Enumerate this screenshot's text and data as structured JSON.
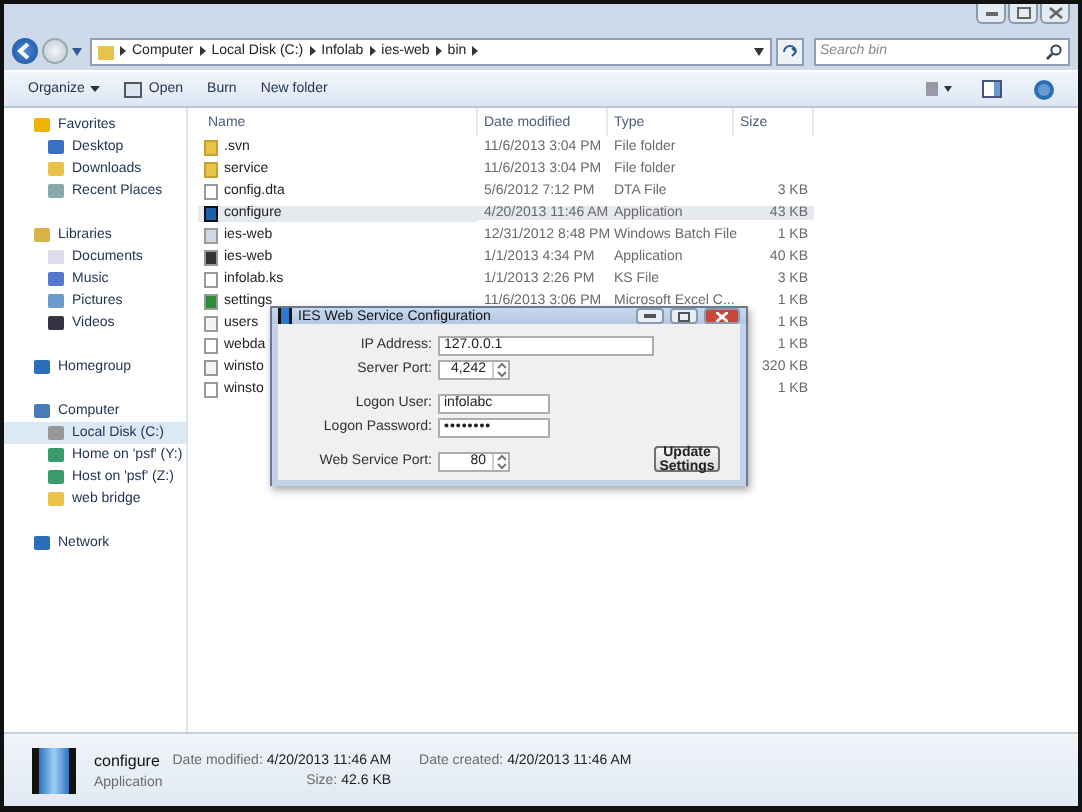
{
  "address_bar": {
    "segments": [
      "Computer",
      "Local Disk (C:)",
      "Infolab",
      "ies-web",
      "bin"
    ]
  },
  "search": {
    "placeholder": "Search bin"
  },
  "toolbar": {
    "buttons": [
      {
        "label": "Organize",
        "kind": "menu"
      },
      {
        "label": "Open",
        "kind": "open"
      },
      {
        "label": "Burn",
        "kind": "plain"
      },
      {
        "label": "New folder",
        "kind": "plain"
      }
    ]
  },
  "sidebar": {
    "groups": [
      {
        "label": "Favorites",
        "kind": "star",
        "children": [
          {
            "label": "Desktop",
            "kind": "desktop",
            "selected": false
          },
          {
            "label": "Downloads",
            "kind": "downloads",
            "selected": false
          },
          {
            "label": "Recent Places",
            "kind": "recent",
            "selected": false
          }
        ]
      },
      {
        "label": "Libraries",
        "kind": "library",
        "children": [
          {
            "label": "Documents",
            "kind": "doc",
            "selected": false
          },
          {
            "label": "Music",
            "kind": "music",
            "selected": false
          },
          {
            "label": "Pictures",
            "kind": "pictures",
            "selected": false
          },
          {
            "label": "Videos",
            "kind": "videos",
            "selected": false
          }
        ]
      },
      {
        "label": "Homegroup",
        "kind": "homegroup"
      },
      {
        "label": "Computer",
        "kind": "computer",
        "children": [
          {
            "label": "Local Disk (C:)",
            "kind": "disk",
            "selected": true
          },
          {
            "label": "Home on 'psf' (Y:)",
            "kind": "netdrive",
            "selected": false
          },
          {
            "label": "Host on 'psf' (Z:)",
            "kind": "netdrive",
            "selected": false
          },
          {
            "label": "web bridge",
            "kind": "folder",
            "selected": false
          }
        ]
      },
      {
        "label": "Network",
        "kind": "network"
      }
    ]
  },
  "table": {
    "columns": [
      "Name",
      "Date modified",
      "Type",
      "Size"
    ],
    "rows": [
      {
        "name": ".svn",
        "kind": "folder",
        "date": "11/6/2013 3:04 PM",
        "type": "File folder",
        "size": "",
        "selected": false
      },
      {
        "name": "service",
        "kind": "folder",
        "date": "11/6/2013 3:04 PM",
        "type": "File folder",
        "size": "",
        "selected": false
      },
      {
        "name": "config.dta",
        "kind": "file",
        "date": "5/6/2012 7:12 PM",
        "type": "DTA File",
        "size": "3 KB",
        "selected": false
      },
      {
        "name": "configure",
        "kind": "app",
        "date": "4/20/2013 11:46 AM",
        "type": "Application",
        "size": "43 KB",
        "selected": true
      },
      {
        "name": "ies-web",
        "kind": "batch",
        "date": "12/31/2012 8:48 PM",
        "type": "Windows Batch File",
        "size": "1 KB",
        "selected": false
      },
      {
        "name": "ies-web",
        "kind": "exe",
        "date": "1/1/2013 4:34 PM",
        "type": "Application",
        "size": "40 KB",
        "selected": false
      },
      {
        "name": "infolab.ks",
        "kind": "file",
        "date": "1/1/2013 2:26 PM",
        "type": "KS File",
        "size": "3 KB",
        "selected": false
      },
      {
        "name": "settings",
        "kind": "excel",
        "date": "11/6/2013 3:06 PM",
        "type": "Microsoft Excel C...",
        "size": "1 KB",
        "selected": false
      },
      {
        "name": "users",
        "kind": "text",
        "date": "",
        "type": "",
        "size": "1 KB",
        "selected": false
      },
      {
        "name": "webda",
        "kind": "file",
        "date": "",
        "type": "",
        "size": "1 KB",
        "selected": false
      },
      {
        "name": "winsto",
        "kind": "text",
        "date": "",
        "type": "",
        "size": "320 KB",
        "selected": false
      },
      {
        "name": "winsto",
        "kind": "file",
        "date": "",
        "type": "",
        "size": "1 KB",
        "selected": false
      }
    ]
  },
  "dialog": {
    "title": "IES Web Service Configuration",
    "fields": [
      {
        "label": "IP Address:",
        "value": "127.0.0.1",
        "kind": "address"
      },
      {
        "label": "Server Port:",
        "value": "4,242",
        "kind": "spin"
      },
      {
        "label": "Logon User:",
        "value": "infolabc",
        "kind": "text"
      },
      {
        "label": "Logon Password:",
        "value": "••••••••",
        "kind": "password"
      },
      {
        "label": "Web Service Port:",
        "value": "80",
        "kind": "spin"
      }
    ],
    "button": "Update Settings"
  },
  "details": {
    "name": "configure",
    "type": "Application",
    "items": [
      {
        "label": "Date modified:",
        "value": "4/20/2013 11:46 AM"
      },
      {
        "label": "Date created:",
        "value": "4/20/2013 11:46 AM"
      },
      {
        "label": "Size:",
        "value": "42.6 KB"
      }
    ]
  }
}
